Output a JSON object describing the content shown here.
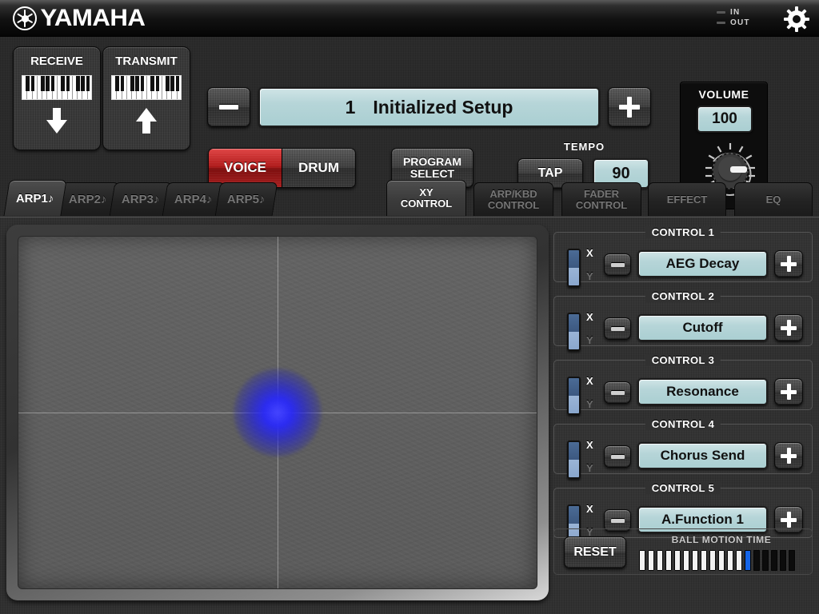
{
  "header": {
    "brand": "YAMAHA",
    "logo_icon": "yamaha-tuning-fork-icon",
    "midi_in_label": "IN",
    "midi_out_label": "OUT",
    "settings_icon": "gear-icon"
  },
  "top": {
    "receive": {
      "title": "RECEIVE",
      "icon": "piano-keyboard-icon",
      "arrow": "arrow-down-icon"
    },
    "transmit": {
      "title": "TRANSMIT",
      "icon": "piano-keyboard-icon",
      "arrow": "arrow-up-icon"
    },
    "minus_label": "-",
    "plus_label": "+",
    "setup": {
      "number": "1",
      "name": "Initialized Setup"
    },
    "voice_label": "VOICE",
    "drum_label": "DRUM",
    "active_sound_mode": "VOICE",
    "program_select_line1": "PROGRAM",
    "program_select_line2": "SELECT",
    "tempo": {
      "title": "TEMPO",
      "tap_label": "TAP",
      "value": "90"
    },
    "volume": {
      "title": "VOLUME",
      "value": "100",
      "knob_icon": "rotary-knob-icon"
    }
  },
  "tabs": {
    "arp": [
      {
        "label": "ARP1",
        "note": "♪",
        "active": true
      },
      {
        "label": "ARP2",
        "note": "♪",
        "active": false
      },
      {
        "label": "ARP3",
        "note": "♪",
        "active": false
      },
      {
        "label": "ARP4",
        "note": "♪",
        "active": false
      },
      {
        "label": "ARP5",
        "note": "♪",
        "active": false
      }
    ],
    "control": [
      {
        "line1": "XY",
        "line2": "CONTROL",
        "active": true
      },
      {
        "line1": "ARP/KBD",
        "line2": "CONTROL",
        "active": false
      },
      {
        "line1": "FADER",
        "line2": "CONTROL",
        "active": false
      },
      {
        "line1": "EFFECT",
        "line2": "",
        "active": false
      },
      {
        "line1": "EQ",
        "line2": "",
        "active": false
      }
    ]
  },
  "xy_pad": {
    "ball_icon": "xy-ball-icon",
    "ball_x_percent": 50,
    "ball_y_percent": 50,
    "ball_color": "#2a2aff"
  },
  "controls": [
    {
      "legend": "CONTROL 1",
      "axis_x": "X",
      "axis_y": "Y",
      "axis_selected": "X",
      "minus": "-",
      "plus": "+",
      "value": "AEG Decay"
    },
    {
      "legend": "CONTROL 2",
      "axis_x": "X",
      "axis_y": "Y",
      "axis_selected": "X",
      "minus": "-",
      "plus": "+",
      "value": "Cutoff"
    },
    {
      "legend": "CONTROL 3",
      "axis_x": "X",
      "axis_y": "Y",
      "axis_selected": "X",
      "minus": "-",
      "plus": "+",
      "value": "Resonance"
    },
    {
      "legend": "CONTROL 4",
      "axis_x": "X",
      "axis_y": "Y",
      "axis_selected": "X",
      "minus": "-",
      "plus": "+",
      "value": "Chorus Send"
    },
    {
      "legend": "CONTROL 5",
      "axis_x": "X",
      "axis_y": "Y",
      "axis_selected": "X",
      "minus": "-",
      "plus": "+",
      "value": "A.Function 1"
    }
  ],
  "bottom": {
    "reset_label": "RESET",
    "ball_motion_title": "BALL MOTION TIME",
    "meter_total": 18,
    "meter_filled": 12,
    "meter_cursor_index": 12
  },
  "colors": {
    "lcd": "#b6d5d8",
    "accent_red": "#b01c1c",
    "accent_blue": "#1565e8",
    "panel": "#313131"
  }
}
